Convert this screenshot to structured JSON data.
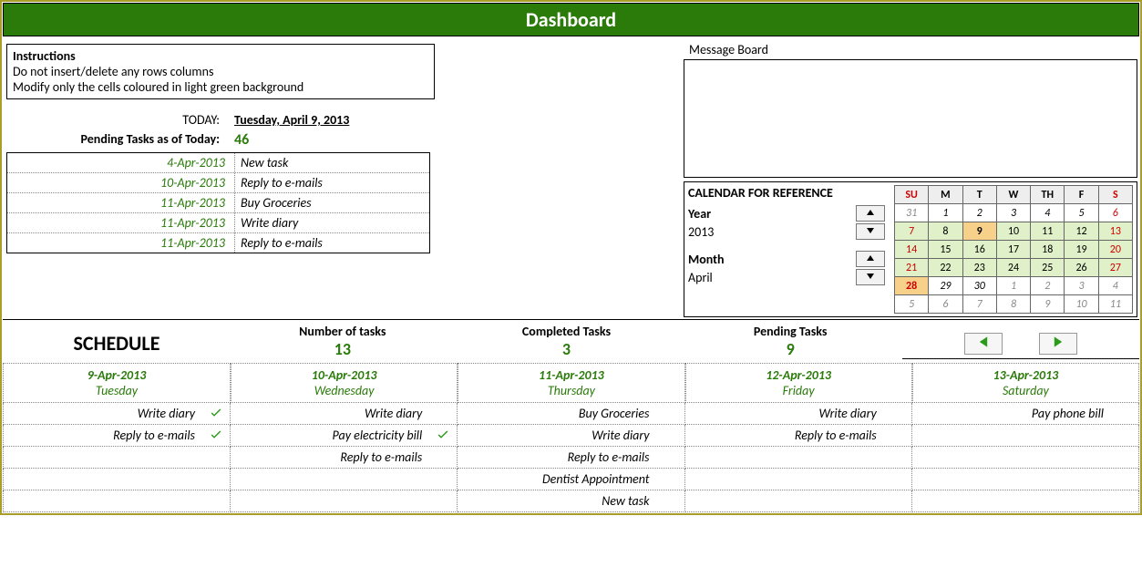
{
  "header": {
    "title": "Dashboard"
  },
  "instructions": {
    "title": "Instructions",
    "line1": "Do not insert/delete any rows columns",
    "line2": "Modify only the cells coloured in light green background"
  },
  "today": {
    "label": "TODAY:",
    "value": "Tuesday, April 9, 2013"
  },
  "pending_total": {
    "label": "Pending Tasks as of Today:",
    "value": "46"
  },
  "pending_list": [
    {
      "date": "4-Apr-2013",
      "task": "New task"
    },
    {
      "date": "10-Apr-2013",
      "task": "Reply to e-mails"
    },
    {
      "date": "11-Apr-2013",
      "task": "Buy Groceries"
    },
    {
      "date": "11-Apr-2013",
      "task": "Write diary"
    },
    {
      "date": "11-Apr-2013",
      "task": "Reply to e-mails"
    }
  ],
  "message_board": {
    "label": "Message Board"
  },
  "calendar": {
    "title": "CALENDAR FOR REFERENCE",
    "year_label": "Year",
    "year_value": "2013",
    "month_label": "Month",
    "month_value": "April",
    "headers": [
      "SU",
      "M",
      "T",
      "W",
      "TH",
      "F",
      "S"
    ],
    "rows": [
      {
        "class": "",
        "cells": [
          {
            "v": "31",
            "c": "other"
          },
          {
            "v": "1",
            "c": ""
          },
          {
            "v": "2",
            "c": ""
          },
          {
            "v": "3",
            "c": ""
          },
          {
            "v": "4",
            "c": ""
          },
          {
            "v": "5",
            "c": ""
          },
          {
            "v": "6",
            "c": "sat"
          }
        ]
      },
      {
        "class": "curweek",
        "cells": [
          {
            "v": "7",
            "c": "sun"
          },
          {
            "v": "8",
            "c": ""
          },
          {
            "v": "9",
            "c": "today"
          },
          {
            "v": "10",
            "c": ""
          },
          {
            "v": "11",
            "c": ""
          },
          {
            "v": "12",
            "c": ""
          },
          {
            "v": "13",
            "c": "sat"
          }
        ]
      },
      {
        "class": "curweek",
        "cells": [
          {
            "v": "14",
            "c": "sun"
          },
          {
            "v": "15",
            "c": ""
          },
          {
            "v": "16",
            "c": ""
          },
          {
            "v": "17",
            "c": ""
          },
          {
            "v": "18",
            "c": ""
          },
          {
            "v": "19",
            "c": ""
          },
          {
            "v": "20",
            "c": "sat"
          }
        ]
      },
      {
        "class": "curweek",
        "cells": [
          {
            "v": "21",
            "c": "sun"
          },
          {
            "v": "22",
            "c": ""
          },
          {
            "v": "23",
            "c": ""
          },
          {
            "v": "24",
            "c": ""
          },
          {
            "v": "25",
            "c": ""
          },
          {
            "v": "26",
            "c": ""
          },
          {
            "v": "27",
            "c": "sat"
          }
        ]
      },
      {
        "class": "",
        "cells": [
          {
            "v": "28",
            "c": "sun today"
          },
          {
            "v": "29",
            "c": ""
          },
          {
            "v": "30",
            "c": ""
          },
          {
            "v": "1",
            "c": "other"
          },
          {
            "v": "2",
            "c": "other"
          },
          {
            "v": "3",
            "c": "other"
          },
          {
            "v": "4",
            "c": "other sat"
          }
        ]
      },
      {
        "class": "",
        "cells": [
          {
            "v": "5",
            "c": "other sun"
          },
          {
            "v": "6",
            "c": "other"
          },
          {
            "v": "7",
            "c": "other"
          },
          {
            "v": "8",
            "c": "other"
          },
          {
            "v": "9",
            "c": "other"
          },
          {
            "v": "10",
            "c": "other"
          },
          {
            "v": "11",
            "c": "other sat"
          }
        ]
      }
    ]
  },
  "stats": {
    "schedule_title": "SCHEDULE",
    "cols": [
      {
        "label": "Number of tasks",
        "value": "13"
      },
      {
        "label": "Completed Tasks",
        "value": "3"
      },
      {
        "label": "Pending Tasks",
        "value": "9"
      }
    ]
  },
  "schedule": {
    "days": [
      {
        "date": "9-Apr-2013",
        "name": "Tuesday",
        "tasks": [
          {
            "t": "Write diary",
            "done": true
          },
          {
            "t": "Reply to e-mails",
            "done": true
          },
          {
            "t": "",
            "done": false
          },
          {
            "t": "",
            "done": false
          },
          {
            "t": "",
            "done": false
          }
        ]
      },
      {
        "date": "10-Apr-2013",
        "name": "Wednesday",
        "tasks": [
          {
            "t": "Write diary",
            "done": false
          },
          {
            "t": "Pay electricity bill",
            "done": true
          },
          {
            "t": "Reply to e-mails",
            "done": false
          },
          {
            "t": "",
            "done": false
          },
          {
            "t": "",
            "done": false
          }
        ]
      },
      {
        "date": "11-Apr-2013",
        "name": "Thursday",
        "tasks": [
          {
            "t": "Buy Groceries",
            "done": false
          },
          {
            "t": "Write diary",
            "done": false
          },
          {
            "t": "Reply to e-mails",
            "done": false
          },
          {
            "t": "Dentist Appointment",
            "done": false
          },
          {
            "t": "New task",
            "done": false
          }
        ]
      },
      {
        "date": "12-Apr-2013",
        "name": "Friday",
        "tasks": [
          {
            "t": "Write diary",
            "done": false
          },
          {
            "t": "Reply to e-mails",
            "done": false
          },
          {
            "t": "",
            "done": false
          },
          {
            "t": "",
            "done": false
          },
          {
            "t": "",
            "done": false
          }
        ]
      },
      {
        "date": "13-Apr-2013",
        "name": "Saturday",
        "tasks": [
          {
            "t": "Pay phone bill",
            "done": false
          },
          {
            "t": "",
            "done": false
          },
          {
            "t": "",
            "done": false
          },
          {
            "t": "",
            "done": false
          },
          {
            "t": "",
            "done": false
          }
        ]
      }
    ]
  }
}
